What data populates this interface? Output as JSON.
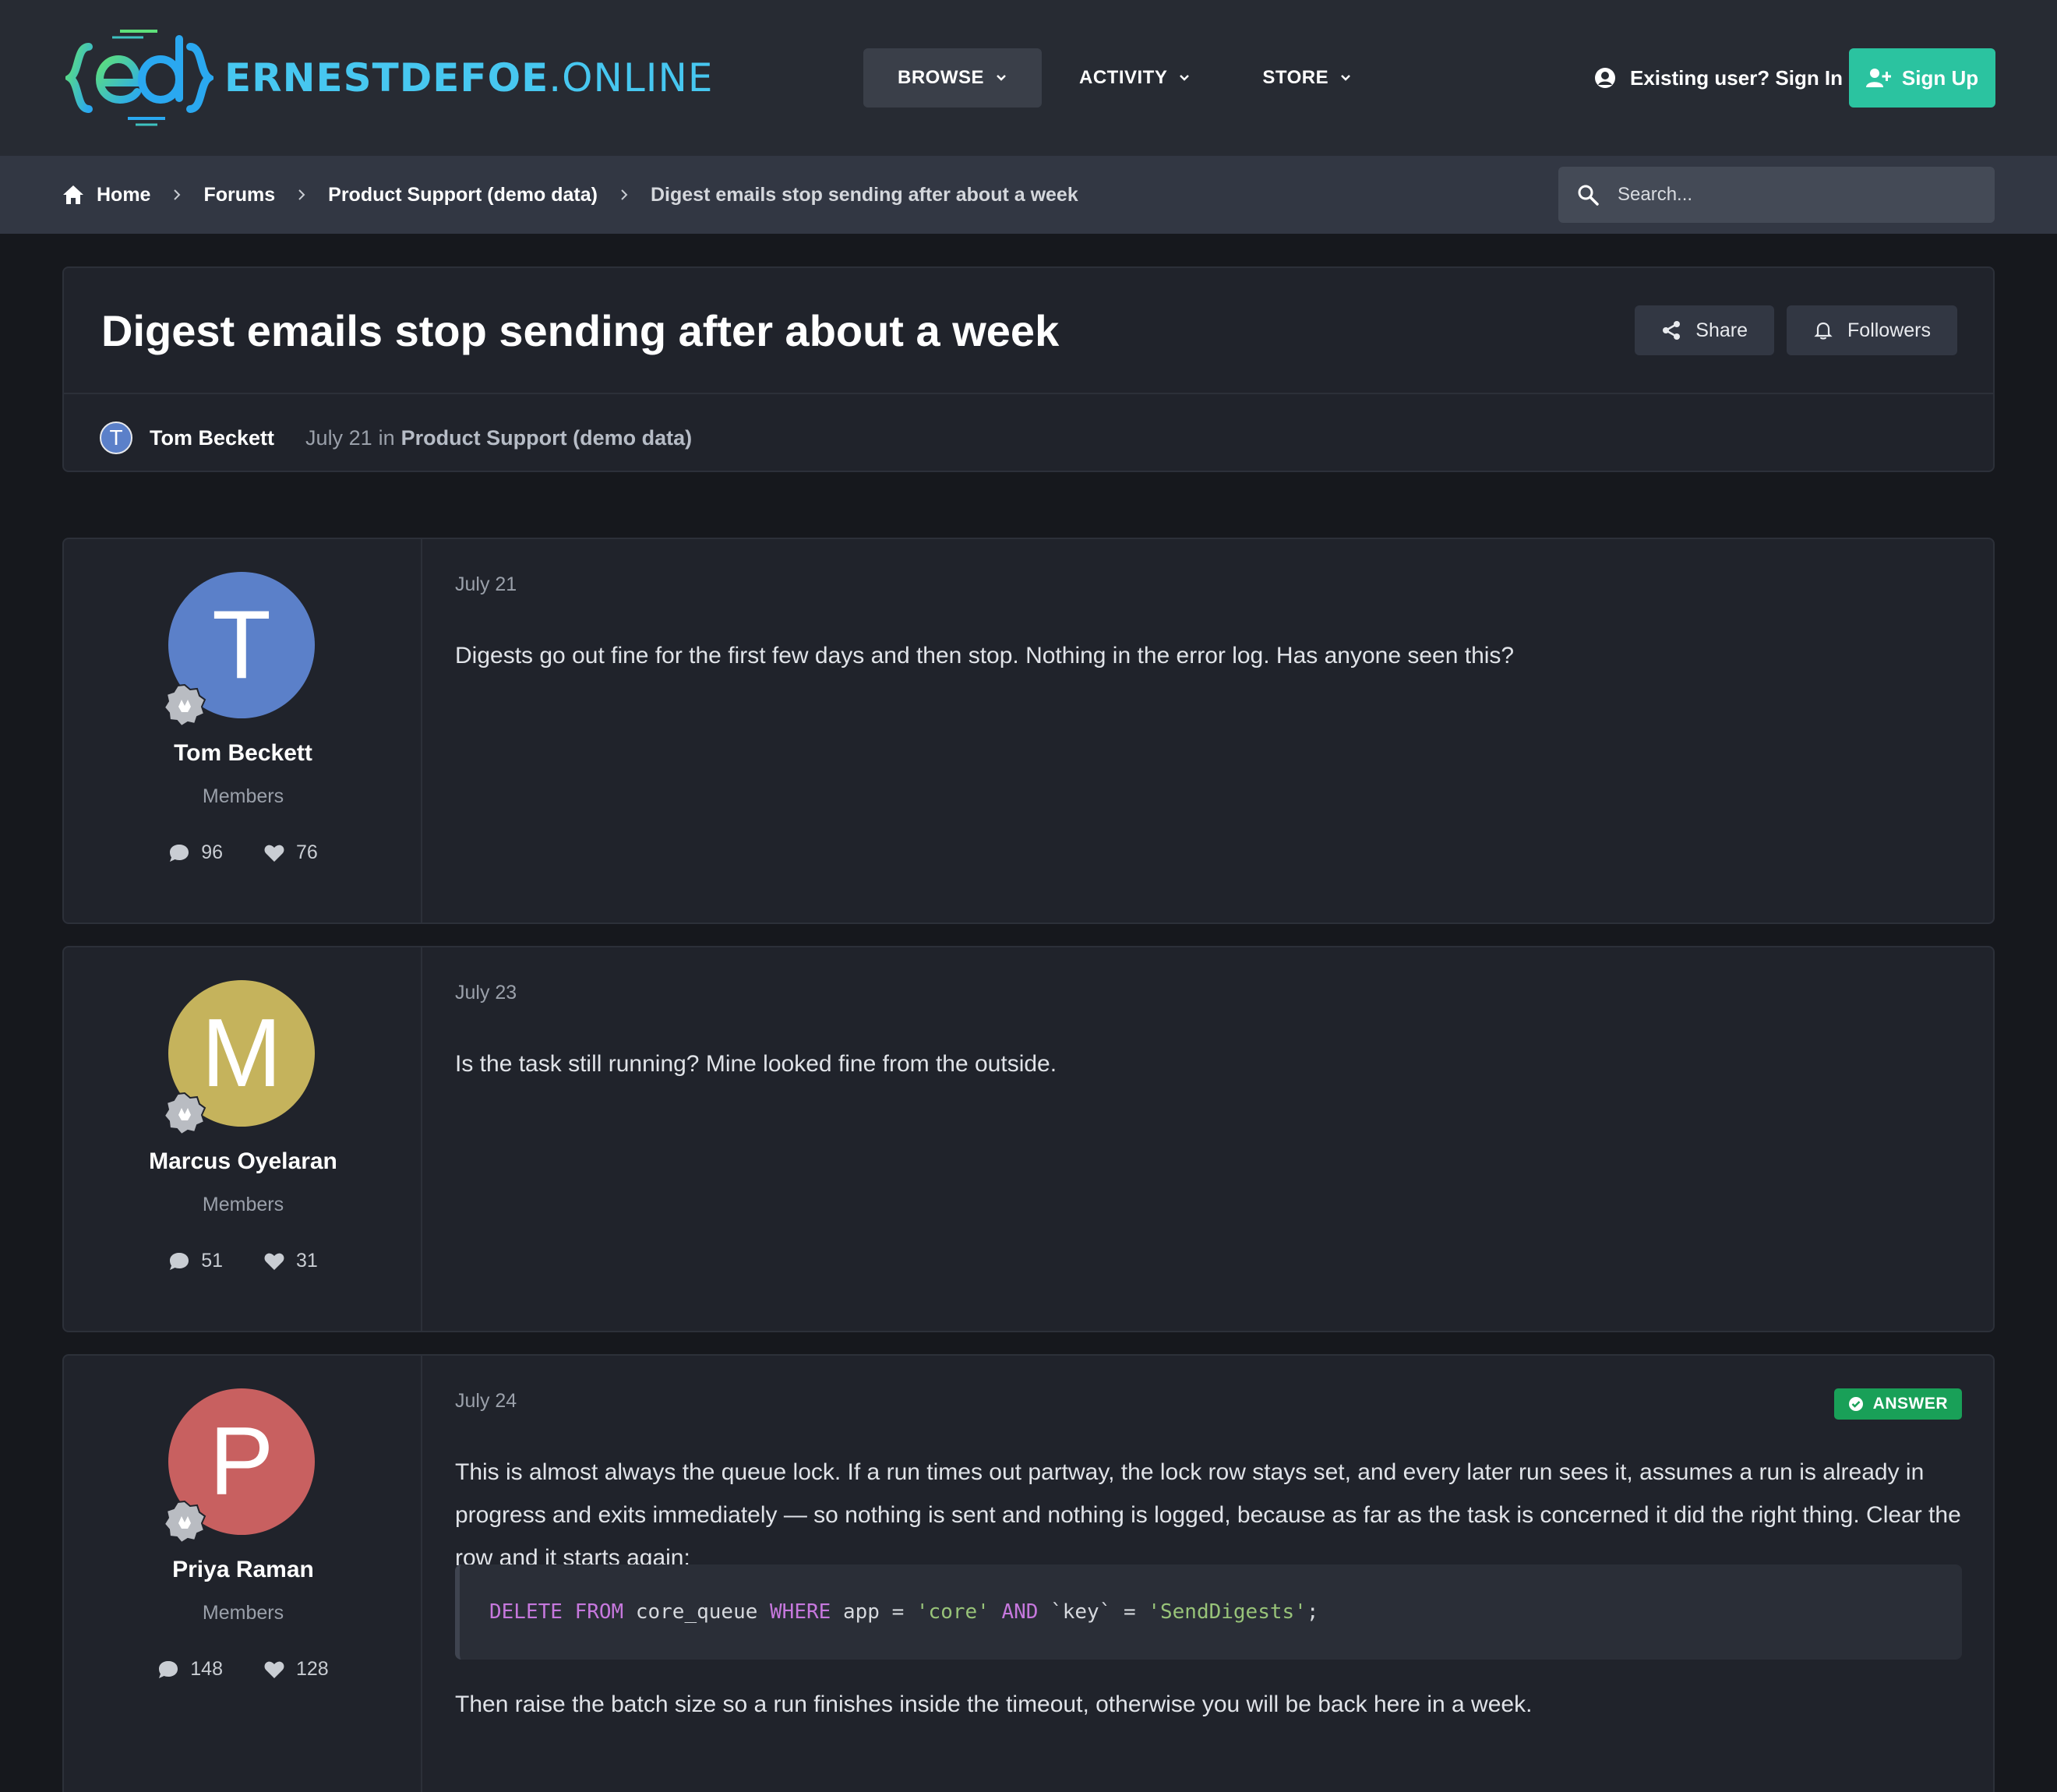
{
  "header": {
    "logo_bold": "ERNESTDEFOE",
    "logo_light": ".ONLINE",
    "nav": [
      {
        "label": "BROWSE"
      },
      {
        "label": "ACTIVITY"
      },
      {
        "label": "STORE"
      }
    ],
    "signin_label": "Existing user? Sign In",
    "signup_label": "Sign Up"
  },
  "breadcrumb": {
    "items": [
      "Home",
      "Forums",
      "Product Support (demo data)"
    ],
    "current": "Digest emails stop sending after about a week"
  },
  "search": {
    "placeholder": "Search..."
  },
  "topic": {
    "title": "Digest emails stop sending after about a week",
    "share_label": "Share",
    "followers_label": "Followers",
    "author_initial": "T",
    "author": "Tom Beckett",
    "date": "July 21",
    "in_word": "in",
    "forum": "Product Support (demo data)"
  },
  "posts": [
    {
      "initial": "T",
      "avatar_color": "#5b80c9",
      "author": "Tom Beckett",
      "group": "Members",
      "posts_count": "96",
      "likes_count": "76",
      "date": "July 21",
      "text": "Digests go out fine for the first few days and then stop. Nothing in the error log. Has anyone seen this?"
    },
    {
      "initial": "M",
      "avatar_color": "#c5b35c",
      "author": "Marcus Oyelaran",
      "group": "Members",
      "posts_count": "51",
      "likes_count": "31",
      "date": "July 23",
      "text": "Is the task still running? Mine looked fine from the outside."
    },
    {
      "initial": "P",
      "avatar_color": "#c86060",
      "author": "Priya Raman",
      "group": "Members",
      "posts_count": "148",
      "likes_count": "128",
      "date": "July 24",
      "badge": "ANSWER",
      "text": "This is almost always the queue lock. If a run times out partway, the lock row stays set, and every later run sees it, assumes a run is already in progress and exits immediately — so nothing is sent and nothing is logged, because as far as the task is concerned it did the right thing. Clear the row and it starts again:",
      "code": {
        "k1": "DELETE FROM",
        "t1": " core_queue ",
        "k2": "WHERE",
        "t2": " app = ",
        "s1": "'core'",
        "t3": " ",
        "k3": "AND",
        "t4": " `key` = ",
        "s2": "'SendDigests'",
        "t5": ";"
      },
      "text2": "Then raise the batch size so a run finishes inside the timeout, otherwise you will be back here in a week."
    }
  ],
  "colors": {
    "accent": "#2bc3a0",
    "answer": "#19a058",
    "logo": "#47c7f0"
  }
}
